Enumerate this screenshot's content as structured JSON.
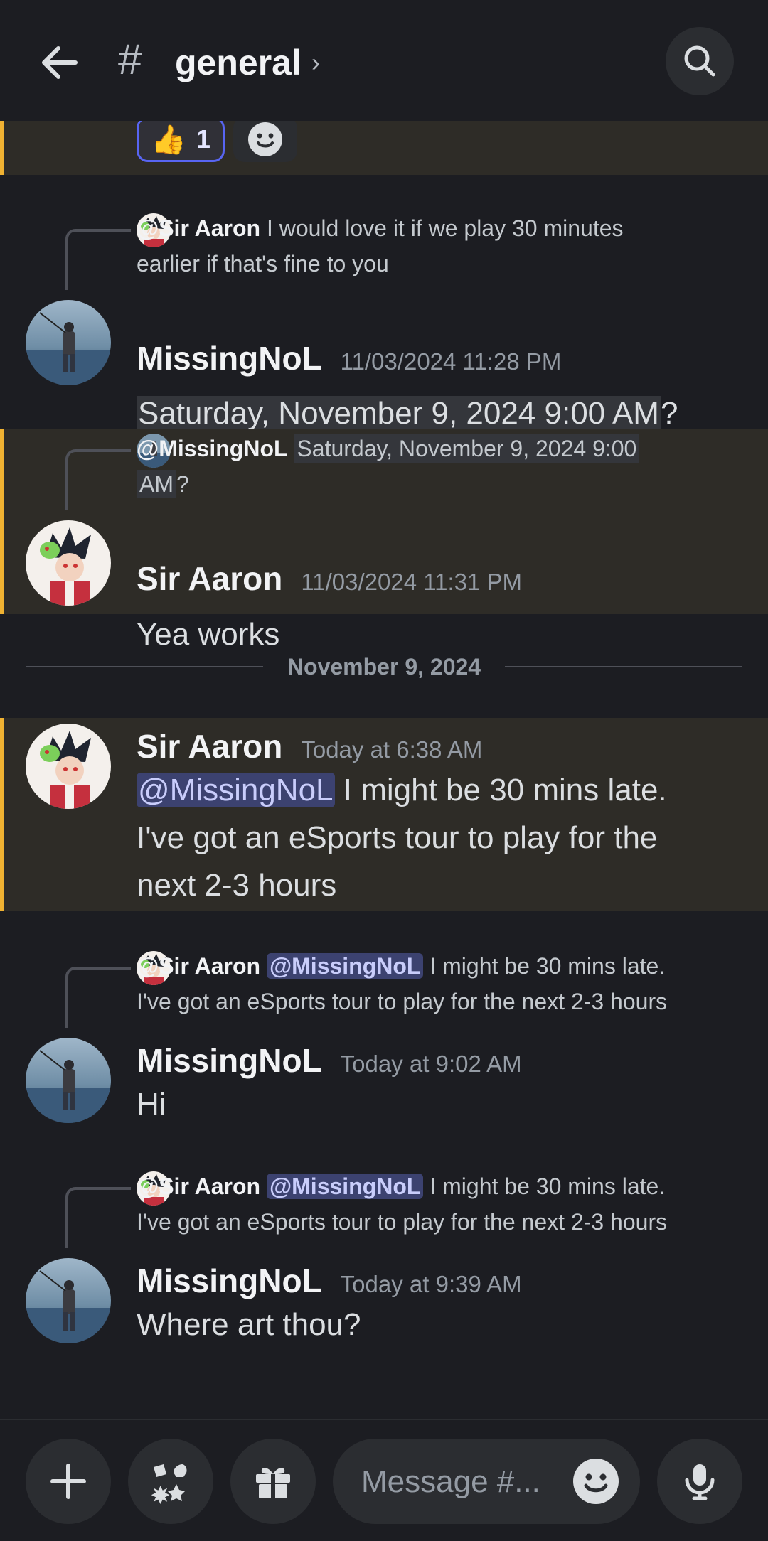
{
  "header": {
    "hash": "#",
    "channel": "general",
    "chevron": "›"
  },
  "reactions": [
    {
      "emoji": "👍",
      "count": "1"
    }
  ],
  "messages": [
    {
      "reply": {
        "name": "@Sir Aaron",
        "text_line1": "I would love it if we play 30 minutes",
        "text_line2": "earlier if that's fine to you"
      },
      "author": "MissingNoL",
      "time": "11/03/2024 11:28 PM",
      "body": {
        "timestamp": "Saturday, November 9, 2024 9:00 AM",
        "suffix": "?"
      }
    },
    {
      "reply": {
        "name": "@MissingNoL",
        "timestamp_part1": "Saturday, November 9, 2024 9:00",
        "timestamp_part2": "AM",
        "suffix": "?"
      },
      "author": "Sir Aaron",
      "time": "11/03/2024 11:31 PM",
      "body": "Yea works"
    }
  ],
  "date_divider": "November 9, 2024",
  "messages2": [
    {
      "author": "Sir Aaron",
      "time": "Today at 6:38 AM",
      "mention": "@MissingNoL",
      "line1": "I might be 30 mins late.",
      "line2": "I've got an eSports tour to play for the",
      "line3": "next 2-3 hours"
    },
    {
      "reply": {
        "name": "@Sir Aaron",
        "mention": "@MissingNoL",
        "text_line1": "I might be 30 mins late.",
        "text_line2": "I've got an eSports tour to play for the next 2-3 hours"
      },
      "author": "MissingNoL",
      "time": "Today at 9:02 AM",
      "body": "Hi"
    },
    {
      "reply": {
        "name": "@Sir Aaron",
        "mention": "@MissingNoL",
        "text_line1": "I might be 30 mins late.",
        "text_line2": "I've got an eSports tour to play for the next 2-3 hours"
      },
      "author": "MissingNoL",
      "time": "Today at 9:39 AM",
      "body": "Where art thou?"
    }
  ],
  "composer": {
    "placeholder": "Message #..."
  },
  "colors": {
    "background": "#1c1d22",
    "highlight": "#2e2c27",
    "highlight_bar": "#f0b232",
    "mention_bg": "#3c4270",
    "blurple": "#5865f2"
  },
  "icons": [
    "back-arrow-icon",
    "search-icon",
    "plus-icon",
    "apps-icon",
    "gift-icon",
    "emoji-icon",
    "microphone-icon"
  ]
}
